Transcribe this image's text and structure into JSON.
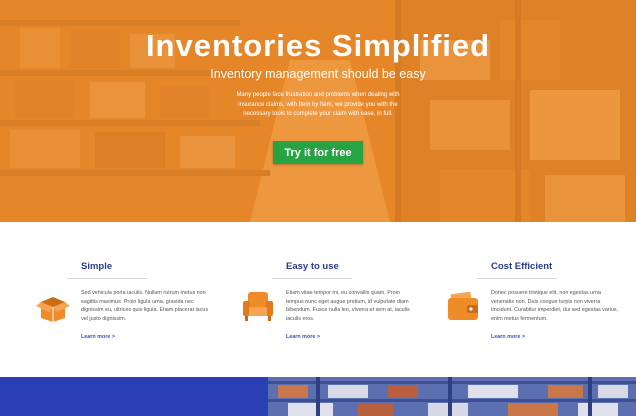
{
  "hero": {
    "title": "Inventories Simplified",
    "subtitle": "Inventory management should be easy",
    "body": "Many people face frustration and problems when dealing with insurance claims, with Item by Item, we provide you with the necessary tools to complete your claim with ease, in full.",
    "cta_label": "Try it for free",
    "cta_color": "#27a343",
    "tint_color": "#f08c28"
  },
  "features": [
    {
      "title": "Simple",
      "icon": "open-box-icon",
      "text": "Sed vehicula porta iaculis. Nullam rutrum metus non sagittis maximus. Proin ligula urna, gravida nec dignissim eu, ultrices quis ligula. Etiam placerat lacus vel justo dignissim.",
      "link": "Learn more >"
    },
    {
      "title": "Easy to use",
      "icon": "armchair-icon",
      "text": "Etiam vitae tempor mi, eu convallis quam. Proin tempus nunc eget augue pretium, id vulputate diam bibendum. Fusce nulla leo, viverra et sem at, iaculis iaculis eros.",
      "link": "Learn more >"
    },
    {
      "title": "Cost Efficient",
      "icon": "wallet-icon",
      "text": "Donec posuere tristique elit, non egestas urna venenatis non. Duis congue turpis non viverra tincidunt. Curabitur imperdiet, dui sed egestas varius, enim metus fermentum.",
      "link": "Learn more >"
    }
  ],
  "colors": {
    "accent_orange": "#f08c28",
    "heading_blue": "#2a3a8c",
    "link_blue": "#3a55b5",
    "footer_blue": "#2b3fb5"
  }
}
